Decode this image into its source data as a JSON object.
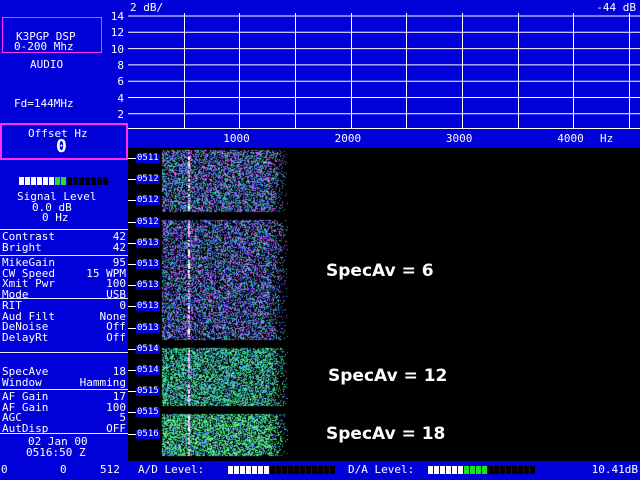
{
  "sidebar": {
    "callsign": "K3PGP DSP",
    "range": "0-200 Mhz",
    "mode_label": "AUDIO",
    "freq_label": "Fd=144MHz",
    "offset_title": "Offset Hz",
    "offset_value": "0",
    "signal_title": "Signal Level",
    "signal_db": "0.0 dB",
    "signal_hz": "0 Hz",
    "signal_meter": {
      "lit_white": 6,
      "lit_green": 2,
      "total": 15
    },
    "params_group1": [
      {
        "label": "Contrast",
        "value": "42"
      },
      {
        "label": "Bright",
        "value": "42"
      }
    ],
    "params_group2": [
      {
        "label": "MikeGain",
        "value": "95"
      },
      {
        "label": "CW Speed",
        "value": "15 WPM"
      },
      {
        "label": "Xmit Pwr",
        "value": "100"
      },
      {
        "label": "Mode",
        "value": "USB"
      }
    ],
    "params_group3": [
      {
        "label": "RIT",
        "value": "0"
      },
      {
        "label": "Aud Filt",
        "value": "None"
      },
      {
        "label": "DeNoise",
        "value": "Off"
      },
      {
        "label": "DelayRt",
        "value": "Off"
      }
    ],
    "params_group4": [
      {
        "label": "SpecAve",
        "value": "18"
      },
      {
        "label": "Window",
        "value": "Hamming"
      }
    ],
    "params_group5": [
      {
        "label": "AF Gain",
        "value": "17"
      },
      {
        "label": "AF Gain",
        "value": "100"
      },
      {
        "label": "AGC",
        "value": "5"
      },
      {
        "label": "AutDisp",
        "value": "OFF"
      }
    ],
    "date": "02 Jan 00",
    "time": "0516:50 Z"
  },
  "spectrum": {
    "scale_label": "2 dB/",
    "ref_level": "-44 dB",
    "y_ticks": [
      "14",
      "12",
      "10",
      "8",
      "6",
      "4",
      "2"
    ],
    "x_ticks": [
      "1000",
      "2000",
      "3000",
      "4000"
    ],
    "x_unit": "Hz",
    "x_max_hz": 4600
  },
  "waterfall": {
    "time_labels": [
      "0511",
      "0512",
      "0512",
      "0512",
      "0513",
      "0513",
      "0513",
      "0513",
      "0513",
      "0514",
      "0514",
      "0515",
      "0515",
      "0516"
    ],
    "annotations": [
      {
        "text": "SpecAv = 6"
      },
      {
        "text": "SpecAv = 12"
      },
      {
        "text": "SpecAv = 18"
      }
    ]
  },
  "bottom": {
    "left_values": [
      "0",
      "0",
      "512"
    ],
    "ad_label": "A/D Level:",
    "da_label": "D/A Level:",
    "db_readout": "10.41dB",
    "ad_meter": {
      "lit_white": 7,
      "lit_green": 0,
      "total": 18
    },
    "da_meter": {
      "lit_white": 6,
      "lit_green": 4,
      "total": 18
    }
  },
  "colors": {
    "panel_blue": "#0000d8",
    "highlight_magenta": "#ff30ff",
    "meter_green": "#20e020"
  }
}
